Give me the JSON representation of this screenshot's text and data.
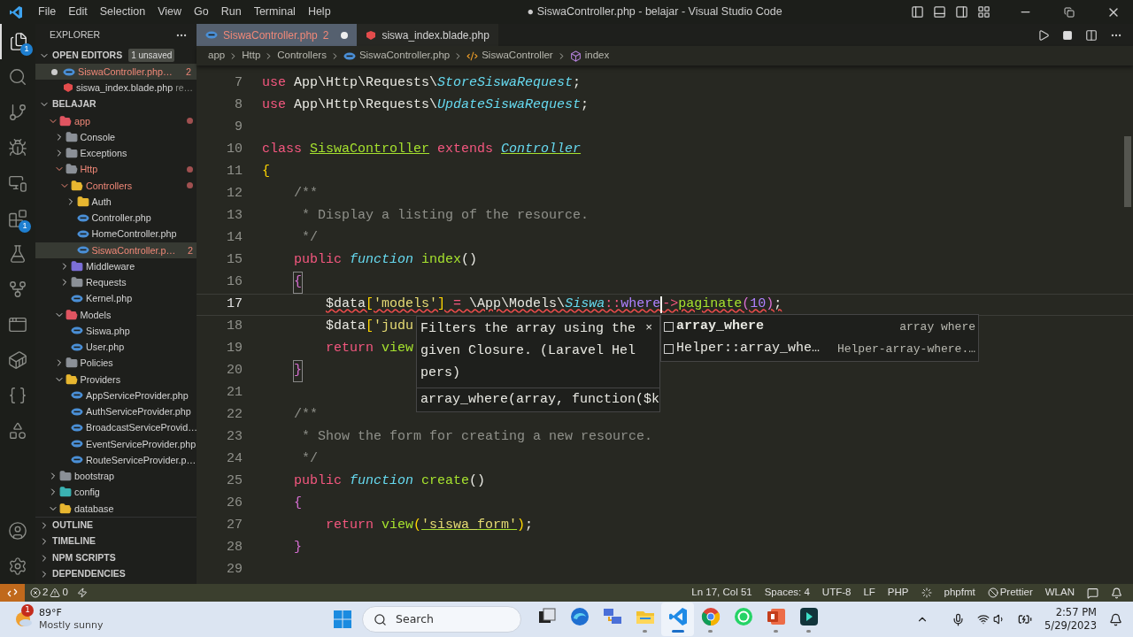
{
  "title_bar": {
    "menu": [
      "File",
      "Edit",
      "Selection",
      "View",
      "Go",
      "Run",
      "Terminal",
      "Help"
    ],
    "title": "● SiswaController.php - belajar - Visual Studio Code"
  },
  "activity_bar": [
    {
      "kind": "explorer",
      "selected": true,
      "badge": "1"
    },
    {
      "kind": "search",
      "selected": false
    },
    {
      "kind": "source_control",
      "selected": false
    },
    {
      "kind": "run_debug",
      "selected": false
    },
    {
      "kind": "remote",
      "selected": false
    },
    {
      "kind": "extensions",
      "selected": false,
      "badge": "1"
    },
    {
      "kind": "testing",
      "selected": false
    },
    {
      "kind": "git_graph",
      "selected": false
    },
    {
      "kind": "api",
      "selected": false
    },
    {
      "kind": "docker",
      "selected": false
    },
    {
      "kind": "python",
      "selected": false
    },
    {
      "kind": "shapes",
      "selected": false
    }
  ],
  "activity_bar_bottom": [
    {
      "kind": "account"
    },
    {
      "kind": "settings"
    }
  ],
  "explorer": {
    "title": "EXPLORER",
    "open_editors": {
      "label": "OPEN EDITORS",
      "expanded": true,
      "badge": "1 unsaved",
      "items": [
        {
          "kind": "php",
          "name": "SiswaController.php…",
          "dirty": true,
          "modified": true,
          "badge": "2",
          "selected": true
        },
        {
          "kind": "blade",
          "name": "siswa_index.blade.php",
          "description": "re…",
          "dirty": false,
          "modified": false,
          "selected": false
        }
      ]
    },
    "project": {
      "label": "BELAJAR",
      "expanded": true,
      "tree": [
        {
          "kind": "folder",
          "name": "app",
          "expanded": true,
          "modified": true,
          "selected": false,
          "color": "#e05561",
          "children": [
            {
              "kind": "folder",
              "name": "Console",
              "expanded": false,
              "modified": false,
              "selected": false,
              "color": "#8b9097"
            },
            {
              "kind": "folder",
              "name": "Exceptions",
              "expanded": false,
              "modified": false,
              "selected": false,
              "color": "#8b9097"
            },
            {
              "kind": "folder",
              "name": "Http",
              "expanded": true,
              "modified": true,
              "selected": false,
              "color": "#8b9097",
              "children": [
                {
                  "kind": "folder",
                  "name": "Controllers",
                  "expanded": true,
                  "modified": true,
                  "selected": false,
                  "color": "#e8b730",
                  "children": [
                    {
                      "kind": "folder",
                      "name": "Auth",
                      "expanded": false,
                      "modified": false,
                      "selected": false,
                      "color": "#e8b730"
                    },
                    {
                      "kind": "php",
                      "name": "Controller.php",
                      "modified": false,
                      "selected": false
                    },
                    {
                      "kind": "php",
                      "name": "HomeController.php",
                      "modified": false,
                      "selected": false
                    },
                    {
                      "kind": "php",
                      "name": "SiswaController.p…",
                      "modified": true,
                      "badge": "2",
                      "selected": true
                    }
                  ]
                },
                {
                  "kind": "folder",
                  "name": "Middleware",
                  "expanded": false,
                  "modified": false,
                  "selected": false,
                  "color": "#7c6fd8"
                },
                {
                  "kind": "folder",
                  "name": "Requests",
                  "expanded": false,
                  "modified": false,
                  "selected": false,
                  "color": "#8b9097"
                },
                {
                  "kind": "php",
                  "name": "Kernel.php",
                  "modified": false,
                  "selected": false
                }
              ]
            },
            {
              "kind": "folder",
              "name": "Models",
              "expanded": true,
              "modified": false,
              "selected": false,
              "color": "#e05561",
              "children": [
                {
                  "kind": "php",
                  "name": "Siswa.php",
                  "modified": false,
                  "selected": false
                },
                {
                  "kind": "php",
                  "name": "User.php",
                  "modified": false,
                  "selected": false
                }
              ]
            },
            {
              "kind": "folder",
              "name": "Policies",
              "expanded": false,
              "modified": false,
              "selected": false,
              "color": "#8b9097"
            },
            {
              "kind": "folder",
              "name": "Providers",
              "expanded": true,
              "modified": false,
              "selected": false,
              "color": "#e8b730",
              "children": [
                {
                  "kind": "php",
                  "name": "AppServiceProvider.php",
                  "modified": false,
                  "selected": false
                },
                {
                  "kind": "php",
                  "name": "AuthServiceProvider.php",
                  "modified": false,
                  "selected": false
                },
                {
                  "kind": "php",
                  "name": "BroadcastServiceProvid…",
                  "modified": false,
                  "selected": false
                },
                {
                  "kind": "php",
                  "name": "EventServiceProvider.php",
                  "modified": false,
                  "selected": false
                },
                {
                  "kind": "php",
                  "name": "RouteServiceProvider.p…",
                  "modified": false,
                  "selected": false
                }
              ]
            }
          ]
        },
        {
          "kind": "folder",
          "name": "bootstrap",
          "expanded": false,
          "modified": false,
          "selected": false,
          "color": "#8b9097"
        },
        {
          "kind": "folder",
          "name": "config",
          "expanded": false,
          "modified": false,
          "selected": false,
          "color": "#3bb3b3"
        },
        {
          "kind": "folder",
          "name": "database",
          "expanded": true,
          "modified": false,
          "selected": false,
          "color": "#e8b730"
        }
      ]
    },
    "panels": [
      {
        "label": "OUTLINE",
        "expanded": false
      },
      {
        "label": "TIMELINE",
        "expanded": false
      },
      {
        "label": "NPM SCRIPTS",
        "expanded": false
      },
      {
        "label": "DEPENDENCIES",
        "expanded": false
      }
    ]
  },
  "tabs": [
    {
      "kind": "php",
      "label": "SiswaController.php",
      "badge": "2",
      "dirty": true,
      "modified": true,
      "selected": true
    },
    {
      "kind": "blade",
      "label": "siswa_index.blade.php",
      "dirty": false,
      "modified": false,
      "selected": false
    }
  ],
  "breadcrumb": [
    {
      "kind": "folder",
      "label": "app"
    },
    {
      "kind": "folder",
      "label": "Http"
    },
    {
      "kind": "folder",
      "label": "Controllers"
    },
    {
      "kind": "php",
      "label": "SiswaController.php"
    },
    {
      "kind": "class",
      "label": "SiswaController"
    },
    {
      "kind": "method",
      "label": "index"
    }
  ],
  "code": [
    {
      "number": "7",
      "tokens": [
        {
          "kind": "keyword",
          "text": "use"
        },
        {
          "kind": "plain",
          "text": " App\\Http\\Requests\\"
        },
        {
          "kind": "type",
          "text": "StoreSiswaRequest"
        },
        {
          "kind": "plain",
          "text": ";"
        }
      ]
    },
    {
      "number": "8",
      "tokens": [
        {
          "kind": "keyword",
          "text": "use"
        },
        {
          "kind": "plain",
          "text": " App\\Http\\Requests\\"
        },
        {
          "kind": "type",
          "text": "UpdateSiswaRequest"
        },
        {
          "kind": "plain",
          "text": ";"
        }
      ]
    },
    {
      "number": "9"
    },
    {
      "number": "10",
      "tokens": [
        {
          "kind": "keyword",
          "text": "class "
        },
        {
          "kind": "declaration",
          "text": "SiswaController"
        },
        {
          "kind": "keyword",
          "text": " extends "
        },
        {
          "kind": "type_link",
          "text": "Controller"
        }
      ]
    },
    {
      "number": "11",
      "tokens": [
        {
          "kind": "bracket1",
          "text": "{"
        }
      ]
    },
    {
      "number": "12",
      "tokens": [
        {
          "kind": "comment",
          "text": "    /**"
        }
      ]
    },
    {
      "number": "13",
      "tokens": [
        {
          "kind": "comment",
          "text": "     * Display a listing of the resource."
        }
      ]
    },
    {
      "number": "14",
      "tokens": [
        {
          "kind": "comment",
          "text": "     */"
        }
      ]
    },
    {
      "number": "15",
      "tokens": [
        {
          "kind": "keyword",
          "text": "    public "
        },
        {
          "kind": "storage",
          "text": "function "
        },
        {
          "kind": "function",
          "text": "index"
        },
        {
          "kind": "plain",
          "text": "()"
        }
      ]
    },
    {
      "number": "16",
      "tokens": [
        {
          "kind": "bracket2",
          "text": "    {",
          "match": true
        }
      ]
    },
    {
      "number": "17",
      "current": true,
      "error": true,
      "tokens": [
        {
          "kind": "plain",
          "text": "        $data"
        },
        {
          "kind": "bracket1",
          "text": "["
        },
        {
          "kind": "string",
          "text": "'models'"
        },
        {
          "kind": "bracket1",
          "text": "]"
        },
        {
          "kind": "operator",
          "text": " = "
        },
        {
          "kind": "plain",
          "text": "\\App\\Models\\"
        },
        {
          "kind": "type",
          "text": "Siswa"
        },
        {
          "kind": "operator",
          "text": "::"
        },
        {
          "kind": "method",
          "text": "where",
          "caret": true
        },
        {
          "kind": "operator",
          "text": "->"
        },
        {
          "kind": "function",
          "text": "paginate"
        },
        {
          "kind": "bracket2",
          "text": "("
        },
        {
          "kind": "number",
          "text": "10"
        },
        {
          "kind": "bracket2",
          "text": ")"
        },
        {
          "kind": "plain",
          "text": ";"
        }
      ]
    },
    {
      "number": "18",
      "tokens": [
        {
          "kind": "plain",
          "text": "        $data"
        },
        {
          "kind": "bracket1",
          "text": "["
        },
        {
          "kind": "string",
          "text": "'judu"
        }
      ]
    },
    {
      "number": "19",
      "tokens": [
        {
          "kind": "keyword",
          "text": "        return "
        },
        {
          "kind": "function",
          "text": "view"
        }
      ]
    },
    {
      "number": "20",
      "tokens": [
        {
          "kind": "bracket2",
          "text": "    }",
          "match": true
        }
      ]
    },
    {
      "number": "21"
    },
    {
      "number": "22",
      "tokens": [
        {
          "kind": "comment",
          "text": "    /**"
        }
      ]
    },
    {
      "number": "23",
      "tokens": [
        {
          "kind": "comment",
          "text": "     * Show the form for creating a new resource."
        }
      ]
    },
    {
      "number": "24",
      "tokens": [
        {
          "kind": "comment",
          "text": "     */"
        }
      ]
    },
    {
      "number": "25",
      "tokens": [
        {
          "kind": "keyword",
          "text": "    public "
        },
        {
          "kind": "storage",
          "text": "function "
        },
        {
          "kind": "function",
          "text": "create"
        },
        {
          "kind": "plain",
          "text": "()"
        }
      ]
    },
    {
      "number": "26",
      "tokens": [
        {
          "kind": "bracket2",
          "text": "    {"
        }
      ]
    },
    {
      "number": "27",
      "tokens": [
        {
          "kind": "keyword",
          "text": "        return "
        },
        {
          "kind": "function",
          "text": "view"
        },
        {
          "kind": "bracket1",
          "text": "("
        },
        {
          "kind": "string_link",
          "text": "'siswa_form'"
        },
        {
          "kind": "bracket1",
          "text": ")"
        },
        {
          "kind": "plain",
          "text": ";"
        }
      ]
    },
    {
      "number": "28",
      "tokens": [
        {
          "kind": "bracket2",
          "text": "    }"
        }
      ]
    },
    {
      "number": "29"
    }
  ],
  "hover": {
    "text": "Filters the array using the given Closure. (Laravel Helpers)",
    "signature": "array_where(array, function($k",
    "close": "×"
  },
  "suggest": [
    {
      "label": "array_where",
      "detail": "array where",
      "selected": true
    },
    {
      "label": "Helper::array_whe…",
      "detail": "Helper-array-where.…",
      "selected": false
    }
  ],
  "status_bar": {
    "errors": "2",
    "warnings": "0",
    "right": [
      {
        "kind": "text",
        "label": "Ln 17, Col 51"
      },
      {
        "kind": "text",
        "label": "Spaces: 4"
      },
      {
        "kind": "text",
        "label": "UTF-8"
      },
      {
        "kind": "text",
        "label": "LF"
      },
      {
        "kind": "text",
        "label": "PHP"
      },
      {
        "kind": "spinner"
      },
      {
        "kind": "text",
        "label": "phpfmt"
      },
      {
        "kind": "prettier",
        "label": "Prettier"
      },
      {
        "kind": "text",
        "label": "WLAN"
      },
      {
        "kind": "feedback"
      },
      {
        "kind": "bell"
      }
    ]
  },
  "taskbar": {
    "weather": {
      "badge": "1",
      "temp": "89°F",
      "desc": "Mostly sunny"
    },
    "search": "Search",
    "apps": [
      {
        "kind": "task_view",
        "running": false,
        "active": false
      },
      {
        "kind": "edge",
        "running": false,
        "active": false
      },
      {
        "kind": "network",
        "running": false,
        "active": false
      },
      {
        "kind": "files",
        "running": true,
        "active": false
      },
      {
        "kind": "vscode",
        "running": true,
        "active": true
      },
      {
        "kind": "chrome",
        "running": true,
        "active": false
      },
      {
        "kind": "whatsapp",
        "running": false,
        "active": false
      },
      {
        "kind": "powerpoint",
        "running": true,
        "active": false
      },
      {
        "kind": "filmora",
        "running": true,
        "active": false
      }
    ],
    "time": "2:57 PM",
    "date": "5/29/2023"
  }
}
